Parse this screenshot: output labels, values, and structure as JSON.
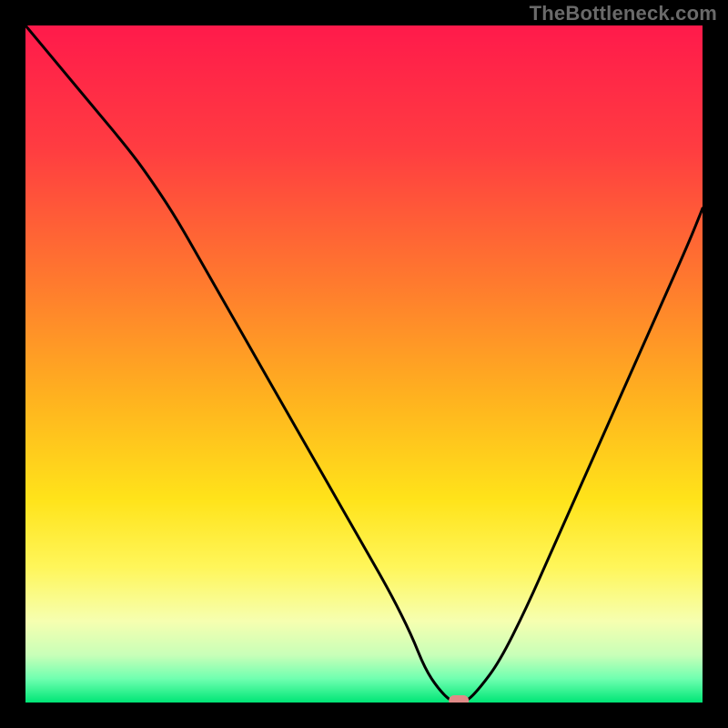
{
  "watermark": "TheBottleneck.com",
  "chart_data": {
    "type": "line",
    "title": "",
    "xlabel": "",
    "ylabel": "",
    "xlim": [
      0,
      100
    ],
    "ylim": [
      0,
      100
    ],
    "grid": false,
    "legend": false,
    "notes": "Gradient-filled chart area (red→orange→yellow→green) with a black V-shaped bottleneck curve. Y values represent relative height (percent of plot). A small rounded marker sits at the curve minimum. No axis ticks or numeric labels are shown.",
    "series": [
      {
        "name": "bottleneck-curve",
        "color": "#000000",
        "x": [
          0,
          5,
          10,
          15,
          18,
          22,
          26,
          30,
          34,
          38,
          42,
          46,
          50,
          54,
          57,
          59,
          61,
          63,
          65,
          67,
          70,
          74,
          78,
          82,
          86,
          90,
          94,
          98,
          100
        ],
        "y": [
          100,
          94,
          88,
          82,
          78,
          72,
          65,
          58,
          51,
          44,
          37,
          30,
          23,
          16,
          10,
          5,
          2,
          0,
          0,
          2,
          6,
          14,
          23,
          32,
          41,
          50,
          59,
          68,
          73
        ]
      }
    ],
    "marker": {
      "x": 64,
      "y": 0,
      "color": "#e08a87",
      "shape": "rounded-rect"
    },
    "background_gradient": {
      "stops": [
        {
          "offset": 0.0,
          "color": "#ff1a4b"
        },
        {
          "offset": 0.18,
          "color": "#ff3c41"
        },
        {
          "offset": 0.38,
          "color": "#ff7a2e"
        },
        {
          "offset": 0.55,
          "color": "#ffb21f"
        },
        {
          "offset": 0.7,
          "color": "#ffe31a"
        },
        {
          "offset": 0.8,
          "color": "#fff65a"
        },
        {
          "offset": 0.88,
          "color": "#f6ffb0"
        },
        {
          "offset": 0.93,
          "color": "#c8ffb8"
        },
        {
          "offset": 0.965,
          "color": "#6fffb0"
        },
        {
          "offset": 1.0,
          "color": "#00e676"
        }
      ]
    }
  }
}
